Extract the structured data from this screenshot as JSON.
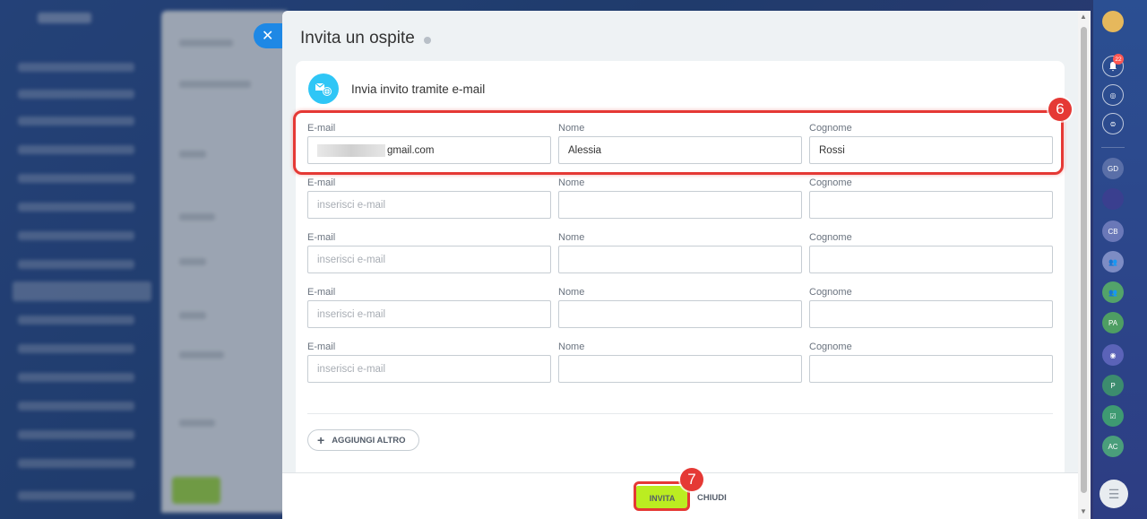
{
  "slider": {
    "title": "Invita un ospite",
    "close_icon": "✕"
  },
  "card": {
    "title": "Invia invito tramite e-mail",
    "icon": "mail-globe-icon"
  },
  "labels": {
    "email": "E-mail",
    "first_name": "Nome",
    "last_name": "Cognome"
  },
  "rows": [
    {
      "email": "gmail.com",
      "email_placeholder": "inserisci e-mail",
      "first_name": "Alessia",
      "last_name": "Rossi",
      "email_masked": true
    },
    {
      "email": "",
      "email_placeholder": "inserisci e-mail",
      "first_name": "",
      "last_name": ""
    },
    {
      "email": "",
      "email_placeholder": "inserisci e-mail",
      "first_name": "",
      "last_name": ""
    },
    {
      "email": "",
      "email_placeholder": "inserisci e-mail",
      "first_name": "",
      "last_name": ""
    },
    {
      "email": "",
      "email_placeholder": "inserisci e-mail",
      "first_name": "",
      "last_name": ""
    }
  ],
  "actions": {
    "add_more": "AGGIUNGI ALTRO",
    "invite": "INVITA",
    "close": "CHIUDI"
  },
  "annotations": {
    "step_6": "6",
    "step_7": "7",
    "color": "#e53935"
  },
  "rightbar": {
    "notif_count": "22",
    "items": [
      "GD",
      "CB",
      "PA",
      "P",
      "AC"
    ]
  },
  "colors": {
    "accent": "#2fc6f6",
    "invite_button": "#bbed21",
    "close_pill": "#1e88e5"
  }
}
